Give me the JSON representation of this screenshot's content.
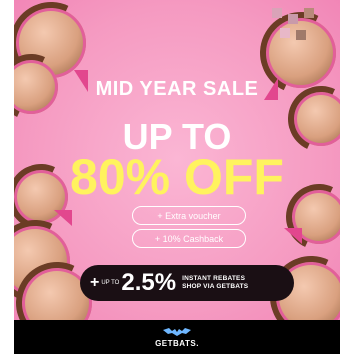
{
  "banner": {
    "subtitle": "MID YEAR SALE",
    "headline_top": "UP TO",
    "headline_main": "80% OFF",
    "pills": [
      {
        "label": "+ Extra voucher"
      },
      {
        "label": "+ 10% Cashback"
      }
    ],
    "rebate": {
      "plus": "+",
      "upto": "UP TO",
      "percent": "2.5%",
      "line1": "INSTANT REBATES",
      "line2": "SHOP VIA GETBATS"
    },
    "footer": {
      "brand": "GETBATS."
    },
    "colors": {
      "background": "#f8a1c7",
      "accent_yellow": "#fff35e",
      "dark": "#1a0f14"
    }
  }
}
